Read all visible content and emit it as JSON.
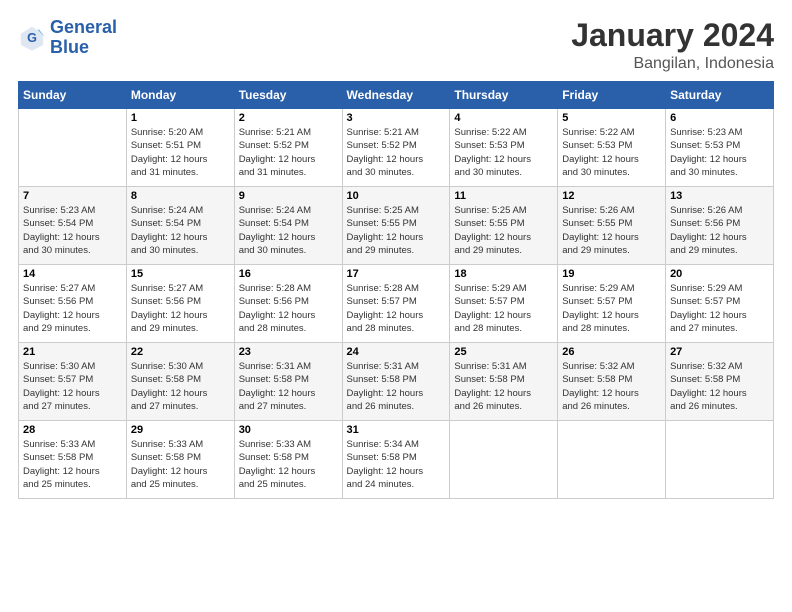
{
  "logo": {
    "text_general": "General",
    "text_blue": "Blue"
  },
  "header": {
    "month": "January 2024",
    "location": "Bangilan, Indonesia"
  },
  "weekdays": [
    "Sunday",
    "Monday",
    "Tuesday",
    "Wednesday",
    "Thursday",
    "Friday",
    "Saturday"
  ],
  "weeks": [
    [
      {
        "day": "",
        "info": ""
      },
      {
        "day": "1",
        "info": "Sunrise: 5:20 AM\nSunset: 5:51 PM\nDaylight: 12 hours\nand 31 minutes."
      },
      {
        "day": "2",
        "info": "Sunrise: 5:21 AM\nSunset: 5:52 PM\nDaylight: 12 hours\nand 31 minutes."
      },
      {
        "day": "3",
        "info": "Sunrise: 5:21 AM\nSunset: 5:52 PM\nDaylight: 12 hours\nand 30 minutes."
      },
      {
        "day": "4",
        "info": "Sunrise: 5:22 AM\nSunset: 5:53 PM\nDaylight: 12 hours\nand 30 minutes."
      },
      {
        "day": "5",
        "info": "Sunrise: 5:22 AM\nSunset: 5:53 PM\nDaylight: 12 hours\nand 30 minutes."
      },
      {
        "day": "6",
        "info": "Sunrise: 5:23 AM\nSunset: 5:53 PM\nDaylight: 12 hours\nand 30 minutes."
      }
    ],
    [
      {
        "day": "7",
        "info": "Sunrise: 5:23 AM\nSunset: 5:54 PM\nDaylight: 12 hours\nand 30 minutes."
      },
      {
        "day": "8",
        "info": "Sunrise: 5:24 AM\nSunset: 5:54 PM\nDaylight: 12 hours\nand 30 minutes."
      },
      {
        "day": "9",
        "info": "Sunrise: 5:24 AM\nSunset: 5:54 PM\nDaylight: 12 hours\nand 30 minutes."
      },
      {
        "day": "10",
        "info": "Sunrise: 5:25 AM\nSunset: 5:55 PM\nDaylight: 12 hours\nand 29 minutes."
      },
      {
        "day": "11",
        "info": "Sunrise: 5:25 AM\nSunset: 5:55 PM\nDaylight: 12 hours\nand 29 minutes."
      },
      {
        "day": "12",
        "info": "Sunrise: 5:26 AM\nSunset: 5:55 PM\nDaylight: 12 hours\nand 29 minutes."
      },
      {
        "day": "13",
        "info": "Sunrise: 5:26 AM\nSunset: 5:56 PM\nDaylight: 12 hours\nand 29 minutes."
      }
    ],
    [
      {
        "day": "14",
        "info": "Sunrise: 5:27 AM\nSunset: 5:56 PM\nDaylight: 12 hours\nand 29 minutes."
      },
      {
        "day": "15",
        "info": "Sunrise: 5:27 AM\nSunset: 5:56 PM\nDaylight: 12 hours\nand 29 minutes."
      },
      {
        "day": "16",
        "info": "Sunrise: 5:28 AM\nSunset: 5:56 PM\nDaylight: 12 hours\nand 28 minutes."
      },
      {
        "day": "17",
        "info": "Sunrise: 5:28 AM\nSunset: 5:57 PM\nDaylight: 12 hours\nand 28 minutes."
      },
      {
        "day": "18",
        "info": "Sunrise: 5:29 AM\nSunset: 5:57 PM\nDaylight: 12 hours\nand 28 minutes."
      },
      {
        "day": "19",
        "info": "Sunrise: 5:29 AM\nSunset: 5:57 PM\nDaylight: 12 hours\nand 28 minutes."
      },
      {
        "day": "20",
        "info": "Sunrise: 5:29 AM\nSunset: 5:57 PM\nDaylight: 12 hours\nand 27 minutes."
      }
    ],
    [
      {
        "day": "21",
        "info": "Sunrise: 5:30 AM\nSunset: 5:57 PM\nDaylight: 12 hours\nand 27 minutes."
      },
      {
        "day": "22",
        "info": "Sunrise: 5:30 AM\nSunset: 5:58 PM\nDaylight: 12 hours\nand 27 minutes."
      },
      {
        "day": "23",
        "info": "Sunrise: 5:31 AM\nSunset: 5:58 PM\nDaylight: 12 hours\nand 27 minutes."
      },
      {
        "day": "24",
        "info": "Sunrise: 5:31 AM\nSunset: 5:58 PM\nDaylight: 12 hours\nand 26 minutes."
      },
      {
        "day": "25",
        "info": "Sunrise: 5:31 AM\nSunset: 5:58 PM\nDaylight: 12 hours\nand 26 minutes."
      },
      {
        "day": "26",
        "info": "Sunrise: 5:32 AM\nSunset: 5:58 PM\nDaylight: 12 hours\nand 26 minutes."
      },
      {
        "day": "27",
        "info": "Sunrise: 5:32 AM\nSunset: 5:58 PM\nDaylight: 12 hours\nand 26 minutes."
      }
    ],
    [
      {
        "day": "28",
        "info": "Sunrise: 5:33 AM\nSunset: 5:58 PM\nDaylight: 12 hours\nand 25 minutes."
      },
      {
        "day": "29",
        "info": "Sunrise: 5:33 AM\nSunset: 5:58 PM\nDaylight: 12 hours\nand 25 minutes."
      },
      {
        "day": "30",
        "info": "Sunrise: 5:33 AM\nSunset: 5:58 PM\nDaylight: 12 hours\nand 25 minutes."
      },
      {
        "day": "31",
        "info": "Sunrise: 5:34 AM\nSunset: 5:58 PM\nDaylight: 12 hours\nand 24 minutes."
      },
      {
        "day": "",
        "info": ""
      },
      {
        "day": "",
        "info": ""
      },
      {
        "day": "",
        "info": ""
      }
    ]
  ]
}
